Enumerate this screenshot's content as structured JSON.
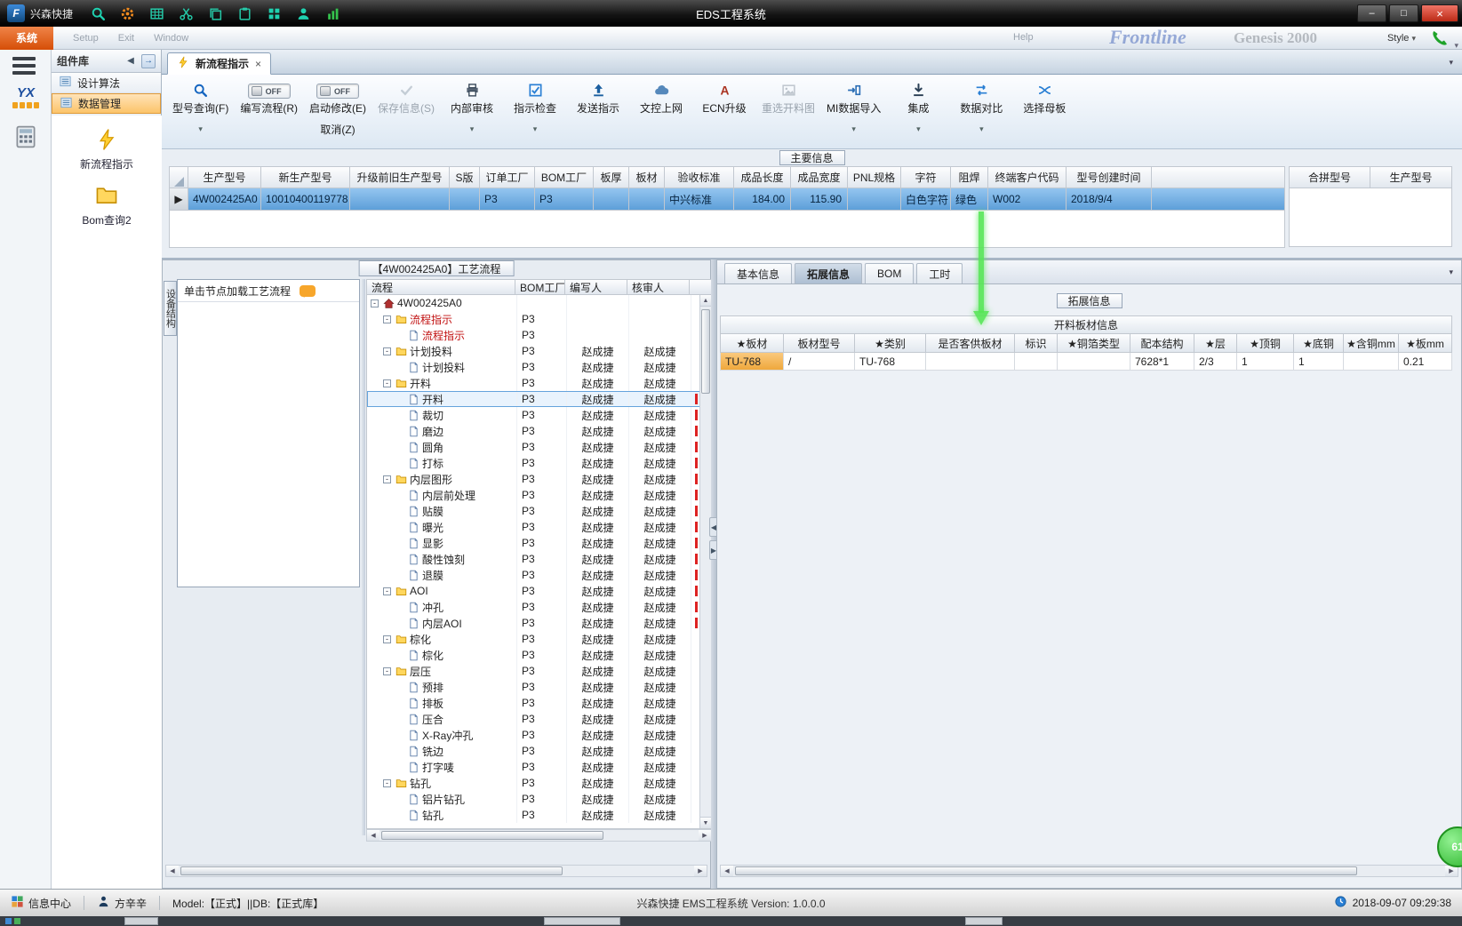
{
  "titlebar": {
    "logo_letter": "F",
    "brand": "兴森快捷",
    "title": "EDS工程系统",
    "icons": [
      "search",
      "gear",
      "table",
      "scissors",
      "copy",
      "paste",
      "grid",
      "user",
      "chart"
    ]
  },
  "menubar": {
    "system_tab": "系统",
    "items": [
      "Setup",
      "Exit",
      "Window"
    ],
    "help": "Help",
    "style_label": "Style",
    "watermark_primary": "Frontline",
    "watermark_secondary": "Genesis 2000"
  },
  "left_rail": {
    "yx_label": "YX"
  },
  "sidebar": {
    "title": "组件库",
    "nav_items": [
      {
        "label": "设计算法",
        "selected": false
      },
      {
        "label": "数据管理",
        "selected": true
      }
    ],
    "tools": [
      {
        "label": "新流程指示",
        "icon": "lightning"
      },
      {
        "label": "Bom查询2",
        "icon": "folder"
      }
    ]
  },
  "tabbar": {
    "active_tab": "新流程指示"
  },
  "toolbar": {
    "buttons": [
      {
        "label": "型号查询(F)",
        "icon": "search",
        "dropdown": true
      },
      {
        "type": "toggle",
        "state": "OFF",
        "label": "编写流程(R)"
      },
      {
        "type": "toggle",
        "state": "OFF",
        "label": "启动修改(E)",
        "sublabel": "取消(Z)"
      },
      {
        "label": "保存信息(S)",
        "icon": "check",
        "disabled": true
      },
      {
        "label": "内部审核",
        "icon": "printer",
        "dropdown": true
      },
      {
        "label": "指示检查",
        "icon": "checkbox",
        "dropdown": true
      },
      {
        "label": "发送指示",
        "icon": "upload"
      },
      {
        "label": "文控上网",
        "icon": "cloud"
      },
      {
        "label": "ECN升级",
        "icon": "letter-a"
      },
      {
        "label": "重选开料图",
        "icon": "image",
        "disabled": true
      },
      {
        "label": "MI数据导入",
        "icon": "import",
        "dropdown": true
      },
      {
        "label": "集成",
        "icon": "download",
        "dropdown": true
      },
      {
        "label": "数据对比",
        "icon": "compare",
        "dropdown": true
      },
      {
        "label": "选择母板",
        "icon": "shuffle"
      }
    ]
  },
  "main_info": {
    "group_label": "主要信息",
    "columns": [
      "生产型号",
      "新生产型号",
      "升级前旧生产型号",
      "S版",
      "订单工厂",
      "BOM工厂",
      "板厚",
      "板材",
      "验收标准",
      "成品长度",
      "成品宽度",
      "PNL规格",
      "字符",
      "阻焊",
      "终端客户代码",
      "型号创建时间"
    ],
    "row": [
      "4W002425A0",
      "10010400119778",
      "",
      "",
      "P3",
      "P3",
      "",
      "",
      "中兴标准",
      "184.00",
      "115.90",
      "",
      "白色字符",
      "绿色",
      "W002",
      "2018/9/4"
    ],
    "side_columns": [
      "合拼型号",
      "生产型号"
    ]
  },
  "process_panel": {
    "title": "【4W002425A0】工艺流程",
    "hint": "单击节点加载工艺流程",
    "side_tab": "设备结构",
    "columns": [
      "流程",
      "BOM工厂",
      "编写人",
      "核审人"
    ],
    "root_label": "4W002425A0",
    "rows": [
      {
        "label": "流程指示",
        "type": "folder",
        "level": 1,
        "bom": "P3",
        "writer": "",
        "auditor": "",
        "red": true
      },
      {
        "label": "流程指示",
        "type": "doc",
        "level": 2,
        "bom": "P3",
        "writer": "",
        "auditor": "",
        "red": true
      },
      {
        "label": "计划投料",
        "type": "folder",
        "level": 1,
        "bom": "P3",
        "writer": "赵成捷",
        "auditor": "赵成捷"
      },
      {
        "label": "计划投料",
        "type": "doc",
        "level": 2,
        "bom": "P3",
        "writer": "赵成捷",
        "auditor": "赵成捷"
      },
      {
        "label": "开料",
        "type": "folder",
        "level": 1,
        "bom": "P3",
        "writer": "赵成捷",
        "auditor": "赵成捷"
      },
      {
        "label": "开料",
        "type": "doc",
        "level": 2,
        "bom": "P3",
        "writer": "赵成捷",
        "auditor": "赵成捷",
        "selected": true,
        "mark": true
      },
      {
        "label": "裁切",
        "type": "doc",
        "level": 2,
        "bom": "P3",
        "writer": "赵成捷",
        "auditor": "赵成捷",
        "mark": true
      },
      {
        "label": "磨边",
        "type": "doc",
        "level": 2,
        "bom": "P3",
        "writer": "赵成捷",
        "auditor": "赵成捷",
        "mark": true
      },
      {
        "label": "圆角",
        "type": "doc",
        "level": 2,
        "bom": "P3",
        "writer": "赵成捷",
        "auditor": "赵成捷",
        "mark": true
      },
      {
        "label": "打标",
        "type": "doc",
        "level": 2,
        "bom": "P3",
        "writer": "赵成捷",
        "auditor": "赵成捷",
        "mark": true
      },
      {
        "label": "内层图形",
        "type": "folder",
        "level": 1,
        "bom": "P3",
        "writer": "赵成捷",
        "auditor": "赵成捷",
        "mark": true
      },
      {
        "label": "内层前处理",
        "type": "doc",
        "level": 2,
        "bom": "P3",
        "writer": "赵成捷",
        "auditor": "赵成捷",
        "mark": true
      },
      {
        "label": "贴膜",
        "type": "doc",
        "level": 2,
        "bom": "P3",
        "writer": "赵成捷",
        "auditor": "赵成捷",
        "mark": true
      },
      {
        "label": "曝光",
        "type": "doc",
        "level": 2,
        "bom": "P3",
        "writer": "赵成捷",
        "auditor": "赵成捷",
        "mark": true
      },
      {
        "label": "显影",
        "type": "doc",
        "level": 2,
        "bom": "P3",
        "writer": "赵成捷",
        "auditor": "赵成捷",
        "mark": true
      },
      {
        "label": "酸性蚀刻",
        "type": "doc",
        "level": 2,
        "bom": "P3",
        "writer": "赵成捷",
        "auditor": "赵成捷",
        "mark": true
      },
      {
        "label": "退膜",
        "type": "doc",
        "level": 2,
        "bom": "P3",
        "writer": "赵成捷",
        "auditor": "赵成捷",
        "mark": true
      },
      {
        "label": "AOI",
        "type": "folder",
        "level": 1,
        "bom": "P3",
        "writer": "赵成捷",
        "auditor": "赵成捷",
        "mark": true
      },
      {
        "label": "冲孔",
        "type": "doc",
        "level": 2,
        "bom": "P3",
        "writer": "赵成捷",
        "auditor": "赵成捷",
        "mark": true
      },
      {
        "label": "内层AOI",
        "type": "doc",
        "level": 2,
        "bom": "P3",
        "writer": "赵成捷",
        "auditor": "赵成捷",
        "mark": true
      },
      {
        "label": "棕化",
        "type": "folder",
        "level": 1,
        "bom": "P3",
        "writer": "赵成捷",
        "auditor": "赵成捷"
      },
      {
        "label": "棕化",
        "type": "doc",
        "level": 2,
        "bom": "P3",
        "writer": "赵成捷",
        "auditor": "赵成捷"
      },
      {
        "label": "层压",
        "type": "folder",
        "level": 1,
        "bom": "P3",
        "writer": "赵成捷",
        "auditor": "赵成捷"
      },
      {
        "label": "预排",
        "type": "doc",
        "level": 2,
        "bom": "P3",
        "writer": "赵成捷",
        "auditor": "赵成捷"
      },
      {
        "label": "排板",
        "type": "doc",
        "level": 2,
        "bom": "P3",
        "writer": "赵成捷",
        "auditor": "赵成捷"
      },
      {
        "label": "压合",
        "type": "doc",
        "level": 2,
        "bom": "P3",
        "writer": "赵成捷",
        "auditor": "赵成捷"
      },
      {
        "label": "X-Ray冲孔",
        "type": "doc",
        "level": 2,
        "bom": "P3",
        "writer": "赵成捷",
        "auditor": "赵成捷"
      },
      {
        "label": "铣边",
        "type": "doc",
        "level": 2,
        "bom": "P3",
        "writer": "赵成捷",
        "auditor": "赵成捷"
      },
      {
        "label": "打字唛",
        "type": "doc",
        "level": 2,
        "bom": "P3",
        "writer": "赵成捷",
        "auditor": "赵成捷"
      },
      {
        "label": "钻孔",
        "type": "folder",
        "level": 1,
        "bom": "P3",
        "writer": "赵成捷",
        "auditor": "赵成捷"
      },
      {
        "label": "铝片钻孔",
        "type": "doc",
        "level": 2,
        "bom": "P3",
        "writer": "赵成捷",
        "auditor": "赵成捷"
      },
      {
        "label": "钻孔",
        "type": "doc",
        "level": 2,
        "bom": "P3",
        "writer": "赵成捷",
        "auditor": "赵成捷"
      }
    ]
  },
  "detail_panel": {
    "tabs": [
      "基本信息",
      "拓展信息",
      "BOM",
      "工时"
    ],
    "active_tab": "拓展信息",
    "group_label": "拓展信息",
    "table_title": "开料板材信息",
    "columns": [
      "★板材",
      "板材型号",
      "★类别",
      "是否客供板材",
      "标识",
      "★铜箔类型",
      "配本结构",
      "★层",
      "★顶铜",
      "★底铜",
      "★含铜mm",
      "★板mm"
    ],
    "row": [
      "TU-768",
      "/",
      "TU-768",
      "",
      "",
      "",
      "7628*1",
      "2/3",
      "1",
      "1",
      "",
      "0.21"
    ],
    "corner_badge": "61"
  },
  "statusbar": {
    "info_center": "信息中心",
    "user": "方辛辛",
    "model_db": "Model:【正式】||DB:【正式库】",
    "app_version": "兴森快捷 EMS工程系统 Version: 1.0.0.0",
    "timestamp": "2018-09-07 09:29:38"
  },
  "colors": {
    "accent_orange": "#d64e07",
    "selection_blue": "#5d9fd9",
    "highlight_green": "#56e656",
    "tree_red": "#c11111"
  }
}
